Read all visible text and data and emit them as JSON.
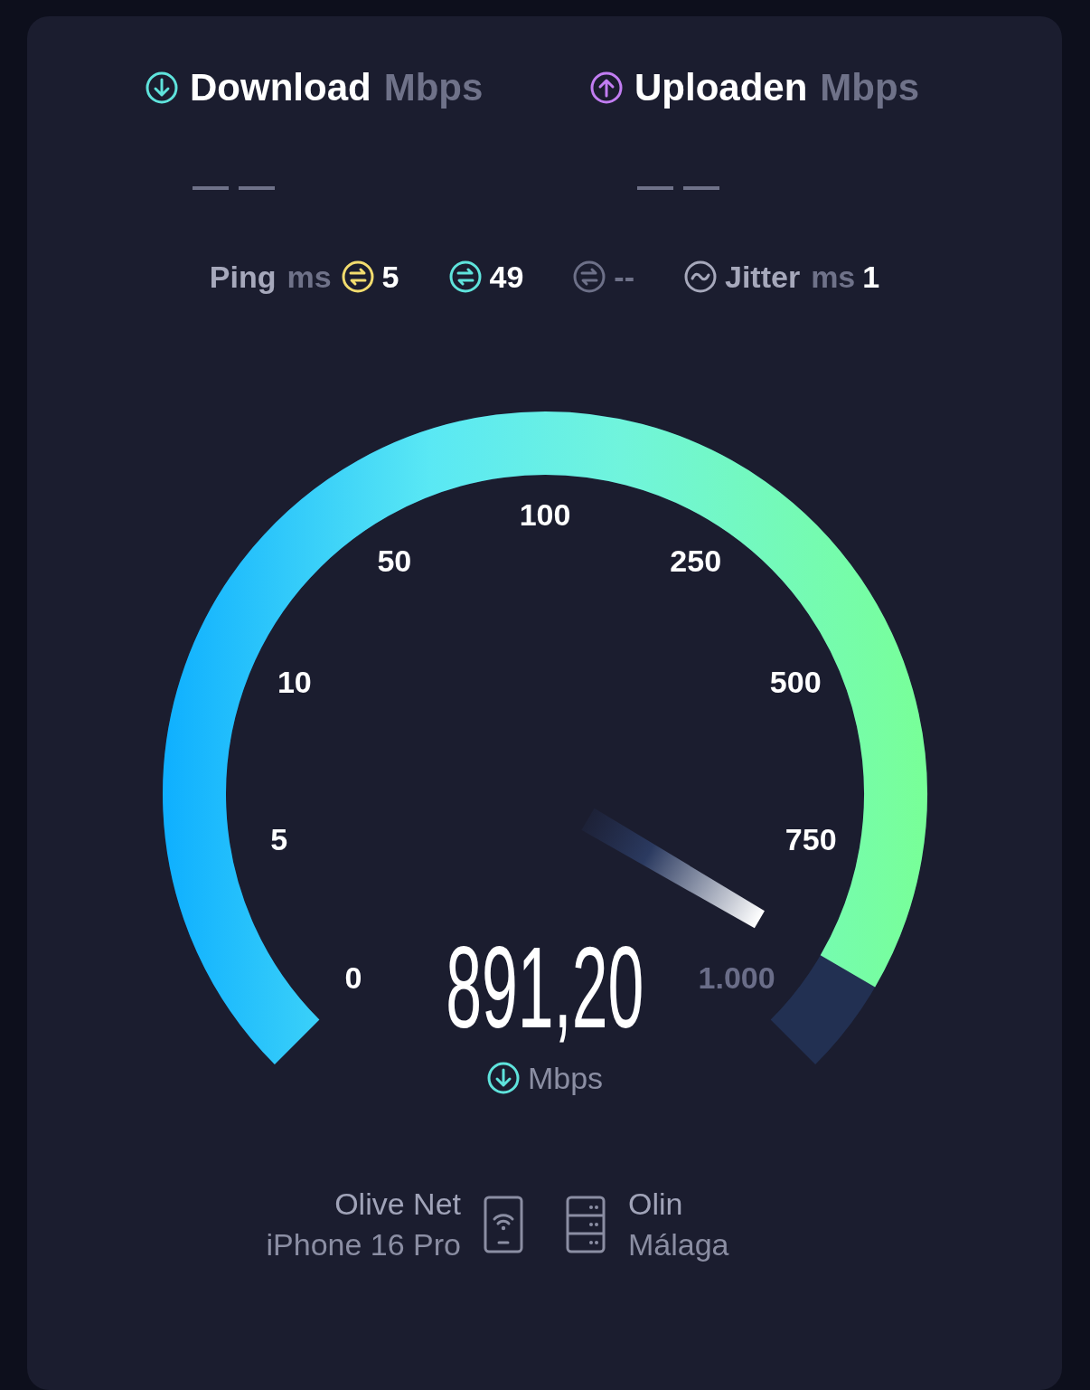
{
  "results": [
    {
      "kind": "download",
      "label": "Download",
      "unit": "Mbps",
      "value": "— —",
      "color": "#5fe3dc"
    },
    {
      "kind": "upload",
      "label": "Uploaden",
      "unit": "Mbps",
      "value": "— —",
      "color": "#c27df2"
    }
  ],
  "latency": {
    "label": "Ping",
    "unit": "ms",
    "readings": [
      {
        "value": "5",
        "color": "#f2dc6e",
        "active": true
      },
      {
        "value": "49",
        "color": "#5fe3dc",
        "active": true
      },
      {
        "value": "--",
        "color": "#6d7088",
        "active": false
      }
    ],
    "jitter": {
      "label": "Jitter",
      "unit": "ms",
      "value": "1"
    }
  },
  "gauge": {
    "kind": "download",
    "reading": "891,20",
    "unit": "Mbps",
    "ticks": [
      {
        "label": "0",
        "reached": true
      },
      {
        "label": "5",
        "reached": true
      },
      {
        "label": "10",
        "reached": true
      },
      {
        "label": "50",
        "reached": true
      },
      {
        "label": "100",
        "reached": true
      },
      {
        "label": "250",
        "reached": true
      },
      {
        "label": "500",
        "reached": true
      },
      {
        "label": "750",
        "reached": true
      },
      {
        "label": "1.000",
        "reached": false
      }
    ]
  },
  "connection": {
    "provider": "Olive Net",
    "device": "iPhone 16 Pro",
    "server": "Olin",
    "location": "Málaga"
  }
}
